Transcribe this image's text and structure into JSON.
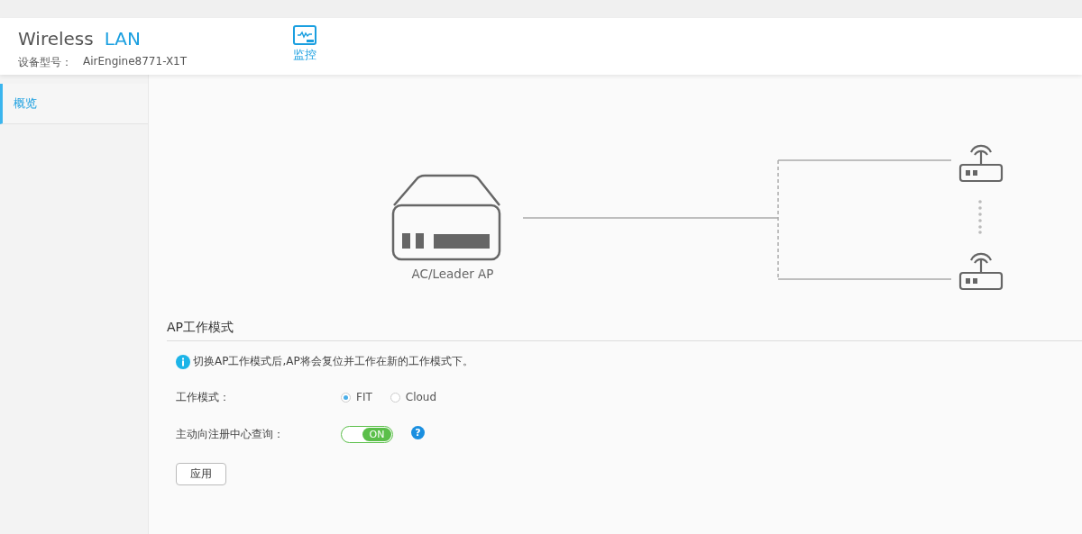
{
  "header": {
    "title": "Wireless",
    "title_accent": "LAN",
    "model_label": "设备型号：",
    "model_value": "AirEngine8771-X1T",
    "nav": [
      {
        "label": "监控",
        "selected": true
      }
    ]
  },
  "sidebar": {
    "items": [
      {
        "label": "概览",
        "selected": true
      }
    ]
  },
  "topology": {
    "controller_label": "AC/Leader AP"
  },
  "ap_mode": {
    "title": "AP工作模式",
    "notice": "切换AP工作模式后,AP将会复位并工作在新的工作模式下。",
    "mode_label": "工作模式：",
    "modes": [
      {
        "label": "FIT",
        "selected": true
      },
      {
        "label": "Cloud",
        "selected": false
      }
    ],
    "query_label": "主动向注册中心查询：",
    "query": {
      "on": true,
      "label": "ON"
    },
    "help": "?",
    "apply": "应用"
  }
}
